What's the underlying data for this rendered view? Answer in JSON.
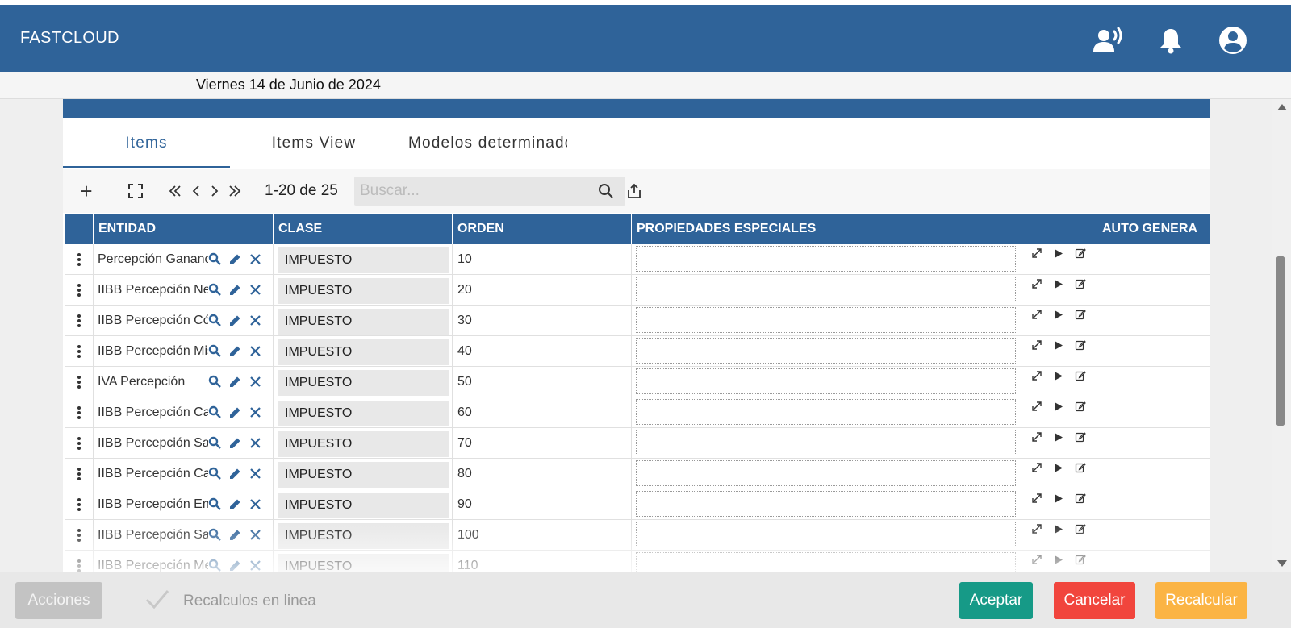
{
  "app": {
    "title": "FASTCLOUD"
  },
  "date_text": "Viernes 14 de Junio de 2024",
  "header_icons": [
    "voice-icon",
    "bell-icon",
    "account-icon"
  ],
  "tabs": [
    {
      "label": "Items",
      "active": true
    },
    {
      "label": "Items View",
      "active": false
    },
    {
      "label": "Modelos determinados",
      "active": false
    }
  ],
  "toolbar": {
    "add": "+",
    "pager_text": "1-20 de 25",
    "search_placeholder": "Buscar..."
  },
  "table": {
    "columns": [
      "ENTIDAD",
      "CLASE",
      "ORDEN",
      "PROPIEDADES ESPECIALES",
      "AUTO GENERA"
    ],
    "rows": [
      {
        "entidad": "Percepción Ganancias",
        "clase": "IMPUESTO",
        "orden": "10"
      },
      {
        "entidad": "IIBB Percepción Neuquén",
        "clase": "IMPUESTO",
        "orden": "20"
      },
      {
        "entidad": "IIBB Percepción Córdoba",
        "clase": "IMPUESTO",
        "orden": "30"
      },
      {
        "entidad": "IIBB Percepción Misiones",
        "clase": "IMPUESTO",
        "orden": "40"
      },
      {
        "entidad": "IVA Percepción",
        "clase": "IMPUESTO",
        "orden": "50"
      },
      {
        "entidad": "IIBB Percepción Catamarca",
        "clase": "IMPUESTO",
        "orden": "60"
      },
      {
        "entidad": "IIBB Percepción Salta",
        "clase": "IMPUESTO",
        "orden": "70"
      },
      {
        "entidad": "IIBB Percepción Capital",
        "clase": "IMPUESTO",
        "orden": "80"
      },
      {
        "entidad": "IIBB Percepción Entre Ríos",
        "clase": "IMPUESTO",
        "orden": "90"
      },
      {
        "entidad": "IIBB Percepción San Luis",
        "clase": "IMPUESTO",
        "orden": "100"
      },
      {
        "entidad": "IIBB Percepción Mendoza",
        "clase": "IMPUESTO",
        "orden": "110"
      }
    ]
  },
  "footer": {
    "acciones": "Acciones",
    "recalculos_label": "Recalculos en linea",
    "aceptar": "Aceptar",
    "cancelar": "Cancelar",
    "recalcular": "Recalcular"
  },
  "colors": {
    "primary": "#2f6399",
    "aceptar": "#169a87",
    "cancelar": "#f1453d",
    "recalcular": "#fbb444",
    "acciones": "#c3c3c3"
  }
}
